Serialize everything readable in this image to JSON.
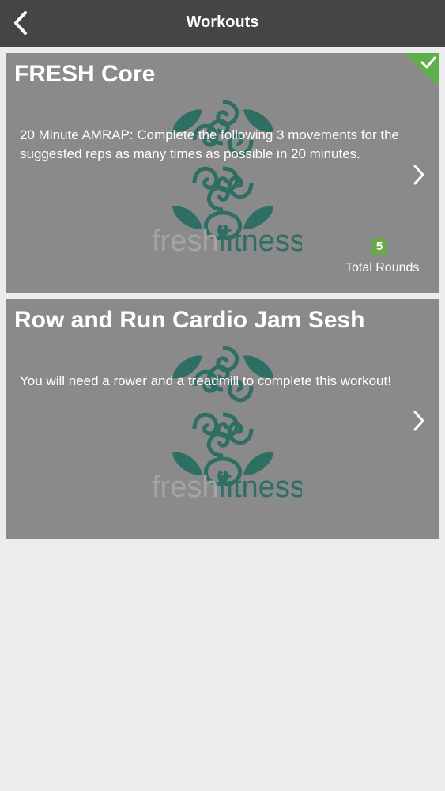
{
  "header": {
    "title": "Workouts",
    "back_icon": "chevron-left-icon"
  },
  "workouts": [
    {
      "title": "FRESH Core",
      "description": "20 Minute AMRAP:  Complete the following 3 movements for the suggested reps as many times as possible in 20 minutes.",
      "completed": true,
      "rounds_value": "5",
      "rounds_label": "Total Rounds",
      "logo_text_left": "fresh",
      "logo_text_right": "fitness"
    },
    {
      "title": "Row and Run Cardio Jam Sesh",
      "description": "You will need a rower and a treadmill to complete this workout!",
      "completed": false,
      "logo_text_left": "fresh",
      "logo_text_right": "fitness"
    }
  ],
  "colors": {
    "header_bg": "#454545",
    "card_bg": "#8a8a8a",
    "logo_teal": "#2e6e63",
    "check_green": "#5fb04a",
    "badge_green": "#6aa84f",
    "page_bg": "#ececec"
  }
}
